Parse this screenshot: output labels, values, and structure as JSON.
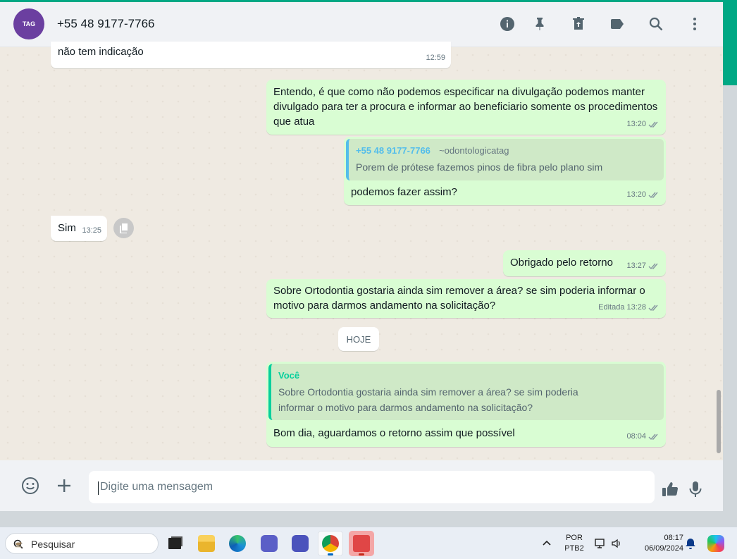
{
  "header": {
    "avatar_text": "TAG",
    "contact": "+55 48 9177-7766",
    "icons": [
      "info-icon",
      "pin-icon",
      "archive-icon",
      "label-icon",
      "search-icon",
      "menu-dots-icon"
    ]
  },
  "messages": {
    "m1": {
      "text": "não tem indicação",
      "time": "12:59"
    },
    "m2": {
      "text": "Entendo, é que como não podemos especificar na divulgação podemos manter divulgado para ter a procura e informar ao beneficiario somente os procedimentos que atua",
      "time": "13:20"
    },
    "m3": {
      "quote_author": "+55 48 9177-7766",
      "quote_sub": "~odontologicatag",
      "quote_text": "Porem de prótese fazemos pinos de fibra pelo plano sim",
      "text": "podemos fazer assim?",
      "time": "13:20"
    },
    "m4": {
      "text": "Sim",
      "time": "13:25"
    },
    "m5": {
      "text": "Obrigado pelo retorno",
      "time": "13:27"
    },
    "m6": {
      "text": "Sobre Ortodontia gostaria ainda sim remover a área? se sim poderia informar o motivo para darmos andamento na solicitação?",
      "edited": "Editada",
      "time": "13:28"
    },
    "m7": {
      "quote_author": "Você",
      "quote_text": "Sobre Ortodontia gostaria ainda sim remover a área? se sim poderia informar o motivo para darmos andamento na solicitação?",
      "text": "Bom dia, aguardamos o retorno assim que possível",
      "time": "08:04"
    }
  },
  "date_divider": "HOJE",
  "composer": {
    "placeholder": "Digite uma mensagem"
  },
  "taskbar": {
    "search_label": "Pesquisar",
    "lang_line1": "POR",
    "lang_line2": "PTB2",
    "time": "08:17",
    "date": "06/09/2024"
  },
  "colors": {
    "accent": "#00a884",
    "outgoing_bubble": "#d9fdd3",
    "incoming_bubble": "#ffffff",
    "quote_blue": "#53bdeb",
    "quote_green": "#06cf9c"
  }
}
